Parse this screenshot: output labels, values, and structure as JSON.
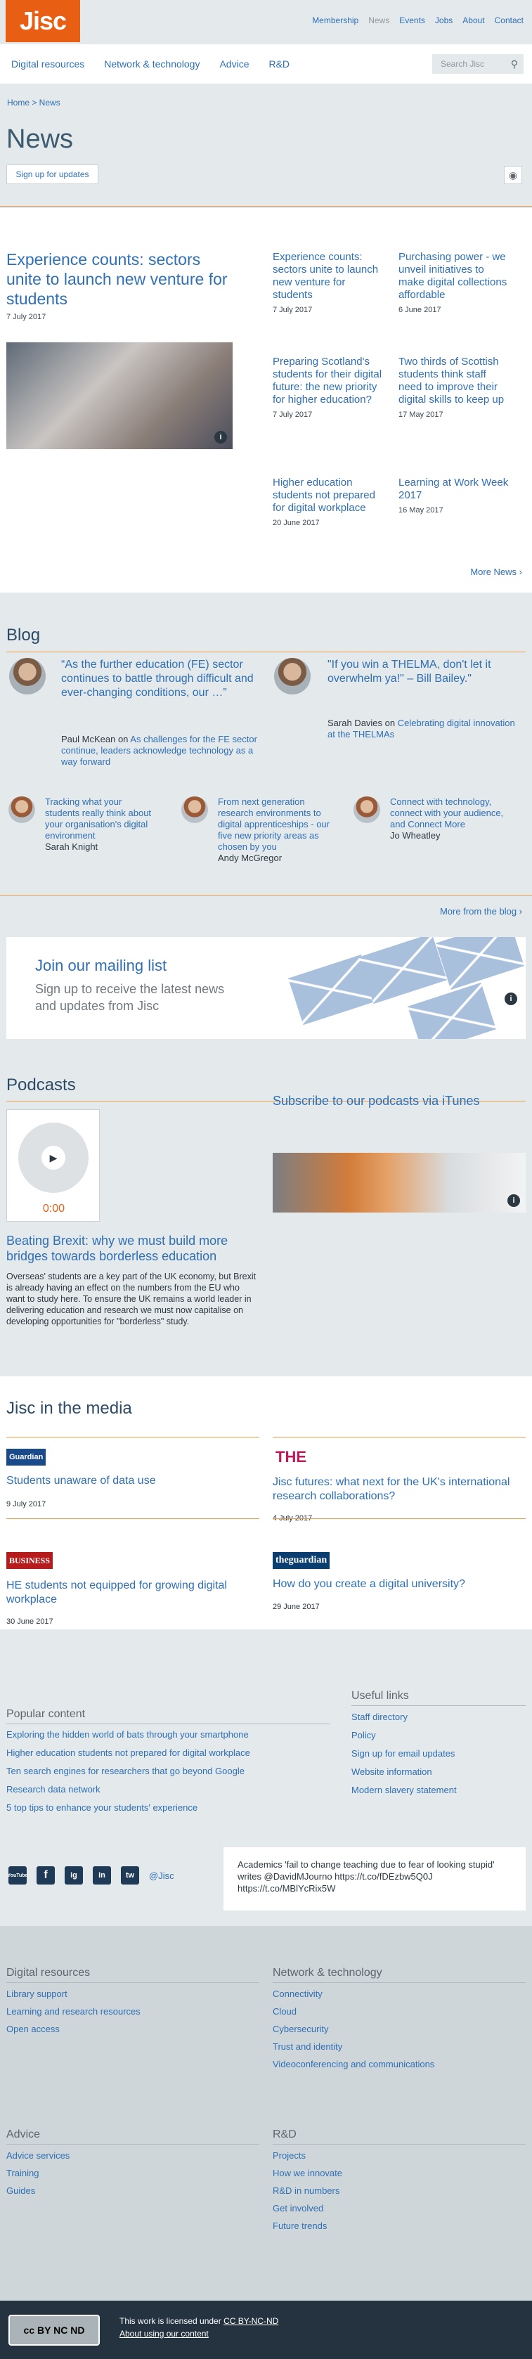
{
  "header": {
    "logo": "Jisc",
    "top_links": [
      "Membership",
      "News",
      "Events",
      "Jobs",
      "About",
      "Contact"
    ],
    "main_links": [
      "Digital resources",
      "Network & technology",
      "Advice",
      "R&D"
    ],
    "search_placeholder": "Search Jisc"
  },
  "breadcrumb": "Home > News",
  "page_title": "News",
  "signup_label": "Sign up for updates",
  "news": {
    "feature": {
      "title": "Experience counts: sectors unite to launch new venture for students",
      "date": "7 July 2017"
    },
    "items": [
      {
        "title": "Experience counts: sectors unite to launch new venture for students",
        "date": "7 July 2017"
      },
      {
        "title": "Purchasing power - we unveil initiatives to make digital collections affordable",
        "date": "6 June 2017"
      },
      {
        "title": "Preparing Scotland's students for their digital future: the new priority for higher education?",
        "date": "7 July 2017"
      },
      {
        "title": "Two thirds of Scottish students think staff need to improve their digital skills to keep up",
        "date": "17 May 2017"
      },
      {
        "title": "Higher education students not prepared for digital workplace",
        "date": "20 June 2017"
      },
      {
        "title": "Learning at Work Week 2017",
        "date": "16 May 2017"
      }
    ],
    "more": "More News ›"
  },
  "blog": {
    "title": "Blog",
    "quotes": [
      {
        "quote": "“As the further education (FE) sector continues to battle through difficult and ever-changing conditions, our …”",
        "author": "Paul McKean",
        "on": " on ",
        "link": "As challenges for the FE sector continue, leaders acknowledge technology as a way forward"
      },
      {
        "quote": "\"If you win a THELMA, don't let it overwhelm ya!\" – Bill Bailey.\"",
        "author": "Sarah Davies",
        "on": " on ",
        "link": "Celebrating digital innovation at the THELMAs"
      }
    ],
    "posts": [
      {
        "title": "Tracking what your students really think about your organisation's digital environment",
        "author": "Sarah Knight"
      },
      {
        "title": "From next generation research environments to digital apprenticeships - our five new priority areas as chosen by you",
        "author": "Andy McGregor"
      },
      {
        "title": "Connect with technology, connect with your audience, and Connect More",
        "author": "Jo Wheatley"
      }
    ],
    "more": "More from the blog ›"
  },
  "mailing": {
    "title": "Join our mailing list",
    "text": "Sign up to receive the latest news and updates from Jisc"
  },
  "podcasts": {
    "title": "Podcasts",
    "time": "0:00",
    "itunes": "Subscribe to our podcasts via iTunes",
    "episode_title": "Beating Brexit: why we must build more bridges towards borderless education",
    "episode_text": "Overseas' students are a key part of the UK economy, but Brexit is already having an effect on the numbers from the EU who want to study here. To ensure the UK remains a world leader in delivering education and research we must now capitalise on developing opportunities for \"borderless\" study."
  },
  "media": {
    "title": "Jisc in the media",
    "items": [
      {
        "logo": "Guardian",
        "title": "Students unaware of data use",
        "date": "9 July 2017"
      },
      {
        "logo": "THE",
        "title": "Jisc futures: what next for the UK's international research collaborations?",
        "date": "4 July 2017"
      },
      {
        "logo": "BUSINESS",
        "title": "HE students not equipped for growing digital workplace",
        "date": "30 June 2017"
      },
      {
        "logo": "theguardian",
        "title": "How do you create a digital university?",
        "date": "29 June 2017"
      }
    ]
  },
  "popular": {
    "title": "Popular content",
    "items": [
      "Exploring the hidden world of bats through your smartphone",
      "Higher education students not prepared for digital workplace",
      "Ten search engines for researchers that go beyond Google",
      "Research data network",
      "5 top tips to enhance your students' experience"
    ]
  },
  "useful": {
    "title": "Useful links",
    "items": [
      "Staff directory",
      "Policy",
      "Sign up for email updates",
      "Website information",
      "Modern slavery statement"
    ]
  },
  "social": {
    "icons": [
      "YouTube",
      "f",
      "ig",
      "in",
      "tw"
    ],
    "handle": "@Jisc"
  },
  "tweet": {
    "text": "Academics 'fail to change teaching due to fear of looking stupid' writes @DavidMJourno https://t.co/fDEzbw5Q0J https://t.co/MBlYcRix5W"
  },
  "footer": {
    "digital": {
      "title": "Digital resources",
      "items": [
        "Library support",
        "Learning and research resources",
        "Open access"
      ]
    },
    "network": {
      "title": "Network & technology",
      "items": [
        "Connectivity",
        "Cloud",
        "Cybersecurity",
        "Trust and identity",
        "Videoconferencing and communications"
      ]
    },
    "advice": {
      "title": "Advice",
      "items": [
        "Advice services",
        "Training",
        "Guides"
      ]
    },
    "rd": {
      "title": "R&D",
      "items": [
        "Projects",
        "How we innovate",
        "R&D in numbers",
        "Get involved",
        "Future trends"
      ]
    },
    "license_prefix": "This work is licensed under ",
    "license": "CC BY-NC-ND",
    "about": "About using our content"
  }
}
